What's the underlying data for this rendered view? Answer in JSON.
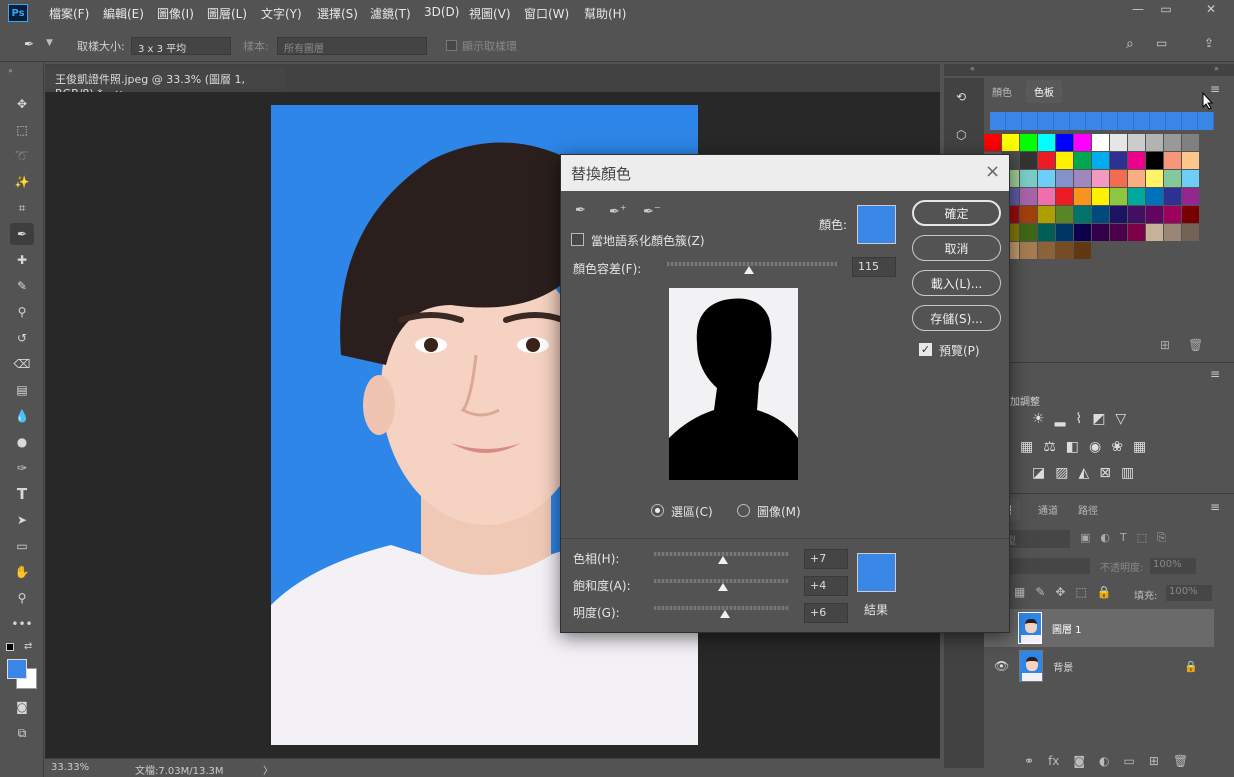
{
  "app": {
    "logo": "Ps"
  },
  "menu": [
    "檔案(F)",
    "編輯(E)",
    "圖像(I)",
    "圖層(L)",
    "文字(Y)",
    "選擇(S)",
    "濾鏡(T)",
    "3D(D)",
    "視圖(V)",
    "窗口(W)",
    "幫助(H)"
  ],
  "options": {
    "sample_size_label": "取樣大小:",
    "sample_size_value": "3 x 3 平均",
    "sample_label": "樣本:",
    "sample_value": "所有圖層",
    "show_ring_label": "顯示取樣環"
  },
  "document": {
    "tab_title": "王俊凱證件照.jpeg @ 33.3% (圖層 1, RGB/8) *",
    "close": "×"
  },
  "status": {
    "zoom": "33.33%",
    "doc_info": "文檔:7.03M/13.3M",
    "arrow": "〉"
  },
  "colors": {
    "foreground": "#3a86e6",
    "background": "#ffffff",
    "canvas_bg": "#2e86e8"
  },
  "swatches_panel": {
    "tab_color": "顏色",
    "tab_swatches": "色板"
  },
  "adjustments_panel": {
    "title": "加調整"
  },
  "layers_panel": {
    "tab_layers": "圖層",
    "tab_channels": "通道",
    "tab_paths": "路徑",
    "kind": "類型",
    "opacity_label": "不透明度:",
    "opacity_value": "100%",
    "fill_label": "填充:",
    "fill_value": "100%",
    "layers": [
      {
        "name": "圖層 1",
        "selected": true,
        "locked": false
      },
      {
        "name": "背景",
        "selected": false,
        "locked": true
      }
    ]
  },
  "dialog": {
    "title": "替換顏色",
    "close": "×",
    "localized_clusters_label": "當地語系化顏色簇(Z)",
    "color_label": "顏色:",
    "selected_color": "#3a86e6",
    "fuzziness_label": "顏色容差(F):",
    "fuzziness_value": "115",
    "fuzziness_fraction": 0.48,
    "buttons": {
      "ok": "確定",
      "cancel": "取消",
      "load": "載入(L)...",
      "save": "存儲(S)..."
    },
    "preview_label": "預覽(P)",
    "preview_checked": true,
    "radio_selection": "選區(C)",
    "radio_image": "圖像(M)",
    "hue_label": "色相(H):",
    "hue_value": "+7",
    "saturation_label": "飽和度(A):",
    "saturation_value": "+4",
    "lightness_label": "明度(G):",
    "lightness_value": "+6",
    "result_label": "結果",
    "result_color": "#3a86e6"
  }
}
